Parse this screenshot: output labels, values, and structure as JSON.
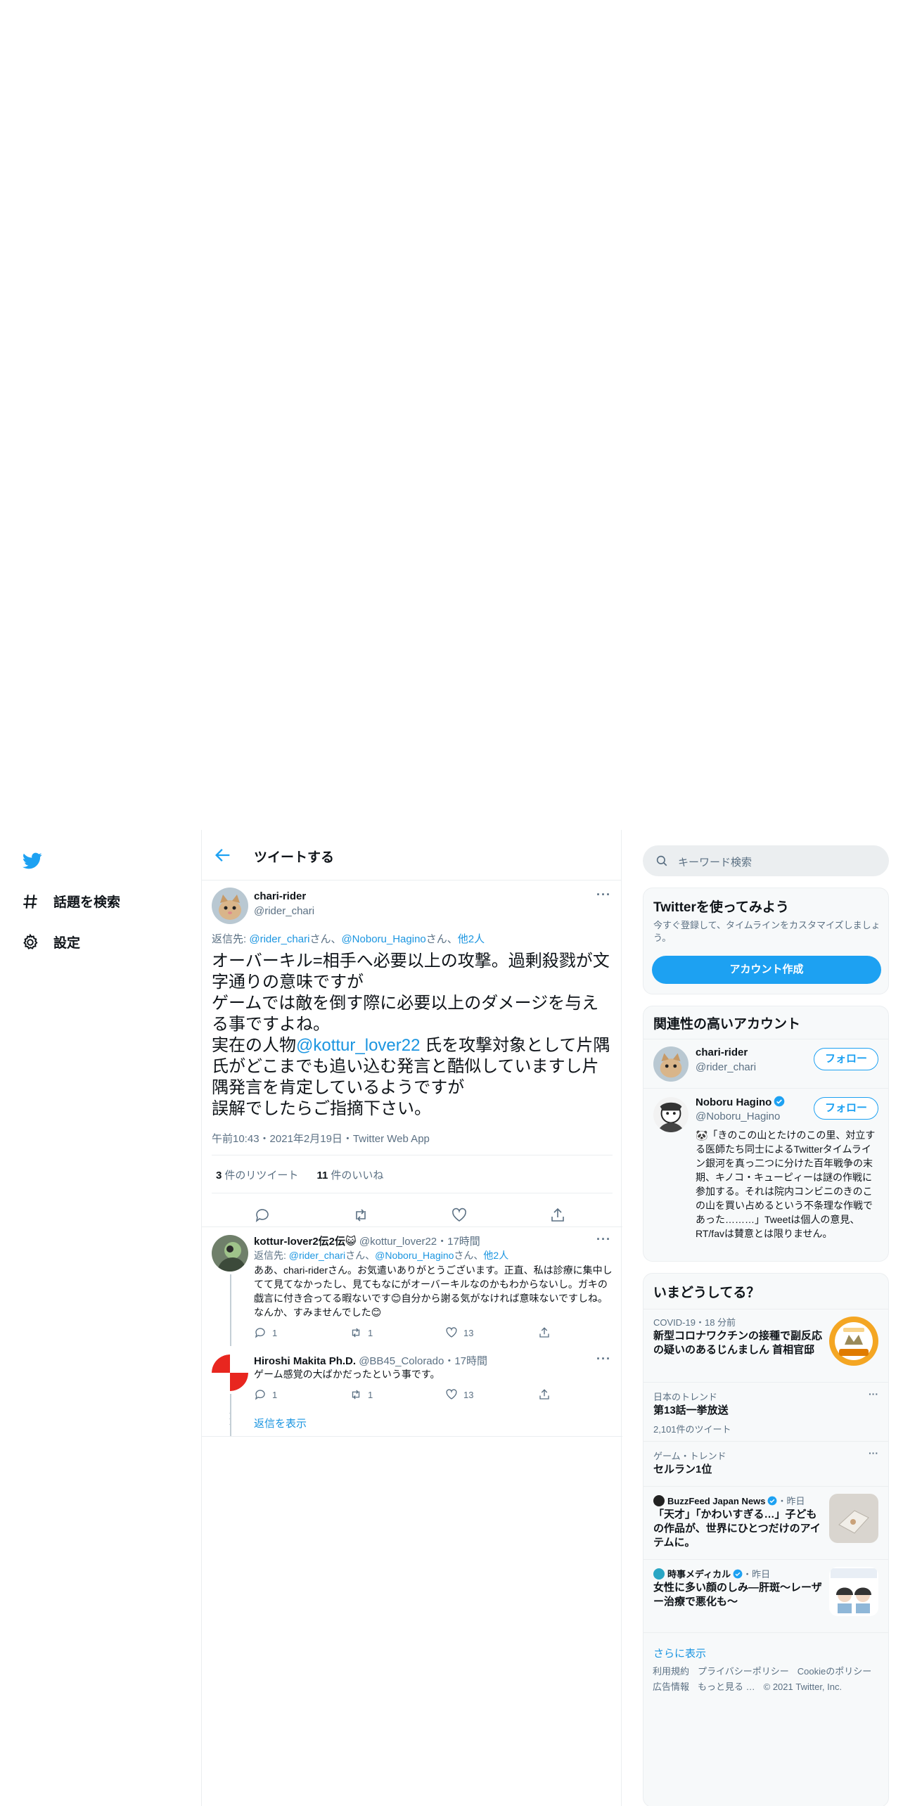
{
  "colors": {
    "brand": "#1da1f2",
    "link": "#1b95e0",
    "text": "#0f1419",
    "muted": "#5b7083",
    "border": "#ebeef0"
  },
  "nav": {
    "logo_icon": "twitter-bird-icon",
    "items": [
      {
        "label": "話題を検索",
        "icon": "hashtag-icon"
      },
      {
        "label": "設定",
        "icon": "gear-icon"
      }
    ]
  },
  "header": {
    "title": "ツイートする",
    "back_icon": "arrow-left-icon"
  },
  "main_tweet": {
    "name": "chari-rider",
    "handle": "@rider_chari",
    "reply_to": {
      "prefix": "返信先: ",
      "u1": "@rider_chari",
      "sep1": "さん、",
      "u2": "@Noboru_Hagino",
      "sep2": "さん、",
      "others": "他2人"
    },
    "body": {
      "l1": "オーバーキル=相手へ必要以上の攻撃。過剰殺戮が文字通りの意味ですが",
      "l2": "ゲームでは敵を倒す際に必要以上のダメージを与える事ですよね。",
      "l3a": "実在の人物",
      "l3mention": "@kottur_lover22",
      "l3b": " 氏を攻撃対象として片隅氏がどこまでも追い込む発言と酷似していますし片隅発言を肯定しているようですが",
      "l4": "誤解でしたらご指摘下さい。"
    },
    "meta": "午前10:43・2021年2月19日・Twitter Web App",
    "retweets": "3",
    "retweets_label": "件のリツイート",
    "likes": "11",
    "likes_label": "件のいいね"
  },
  "replies": [
    {
      "name": "kottur-lover2伝2伝😺",
      "handle": "@kottur_lover22",
      "time": "・17時間",
      "reply_to": {
        "prefix": "返信先: ",
        "u1": "@rider_chari",
        "sep1": "さん、",
        "u2": "@Noboru_Hagino",
        "sep2": "さん、",
        "others": "他2人"
      },
      "text": "ああ、chari-riderさん。お気遣いありがとうございます。正直、私は診療に集中してて見てなかったし、見てもなにがオーバーキルなのかもわからないし。ガキの戯言に付き合ってる暇ないです😊自分から謝る気がなければ意味ないですしね。なんか、すみませんでした😊",
      "replies": "1",
      "retweets": "1",
      "likes": "13"
    },
    {
      "name": "Hiroshi Makita Ph.D.",
      "handle": "@BB45_Colorado",
      "time": "・17時間",
      "text": "ゲーム感覚の大ばかだったという事です。",
      "replies": "1",
      "retweets": "1",
      "likes": "13"
    }
  ],
  "show_replies": "返信を表示",
  "search": {
    "placeholder": "キーワード検索"
  },
  "signup": {
    "title": "Twitterを使ってみよう",
    "subtitle": "今すぐ登録して、タイムラインをカスタマイズしましょう。",
    "button": "アカウント作成"
  },
  "relevant": {
    "title": "関連性の高いアカウント",
    "follow_label": "フォロー",
    "accounts": [
      {
        "name": "chari-rider",
        "handle": "@rider_chari",
        "bio": ""
      },
      {
        "name": "Noboru Hagino",
        "handle": "@Noboru_Hagino",
        "verified": true,
        "bio": "🐼「きのこの山とたけのこの里、対立する医師たち同士によるTwitterタイムライン銀河を真っ二つに分けた百年戦争の末期、キノコ・キューピィーは謎の作戦に参加する。それは院内コンビニのきのこの山を買い占めるという不条理な作戦であった………」Tweetは個人の意見、RT/favは賛意とは限りません。"
      }
    ]
  },
  "trends": {
    "title": "いまどうしてる？",
    "items": [
      {
        "context": "COVID-19・18 分前",
        "title": "新型コロナワクチンの接種で副反応の疑いのあるじんましん 首相官邸"
      },
      {
        "context": "日本のトレンド",
        "title": "第13話一挙放送",
        "count": "2,101件のツイート"
      },
      {
        "context": "ゲーム・トレンド",
        "title": "セルラン1位"
      },
      {
        "source": "BuzzFeed Japan News",
        "time": "・昨日",
        "title": "「天才」「かわいすぎる…」子どもの作品が、世界にひとつだけのアイテムに。"
      },
      {
        "source": "時事メディカル",
        "time": "・昨日",
        "title": "女性に多い顔のしみ―肝斑～レーザー治療で悪化も～"
      }
    ],
    "more_dots": "···",
    "show_more": "さらに表示"
  },
  "footer": {
    "links": [
      "利用規約",
      "プライバシーポリシー",
      "Cookieのポリシー",
      "広告情報",
      "もっと見る …"
    ],
    "copyright": "© 2021 Twitter, Inc."
  }
}
